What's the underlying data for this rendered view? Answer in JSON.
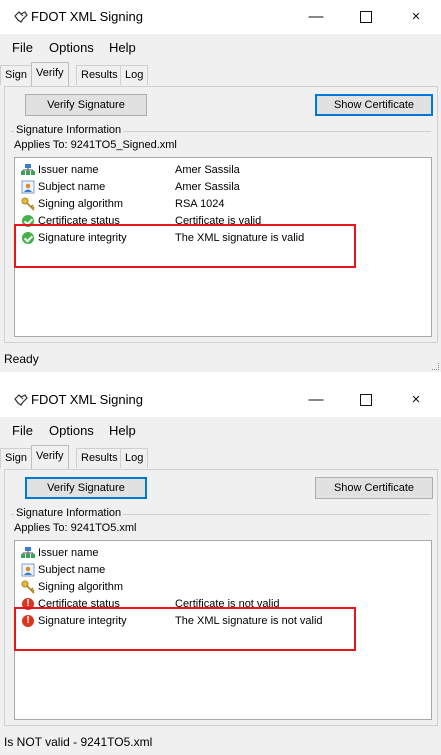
{
  "app_title": "FDOT XML Signing",
  "window_controls": {
    "minimize": "—",
    "close": "×"
  },
  "menu": [
    "File",
    "Options",
    "Help"
  ],
  "tabs": [
    "Sign",
    "Verify",
    "Results",
    "Log"
  ],
  "active_tab": "Verify",
  "buttons": {
    "verify": "Verify Signature",
    "show_certificate": "Show Certificate"
  },
  "group_label": "Signature Information",
  "highlight_color": "#e8141e",
  "windows": [
    {
      "applies_to": "Applies To: 9241TO5_Signed.xml",
      "rows": [
        {
          "name": "Issuer name",
          "value": "Amer Sassila",
          "icon": "issuer-icon"
        },
        {
          "name": "Subject name",
          "value": "Amer Sassila",
          "icon": "subject-icon"
        },
        {
          "name": "Signing algorithm",
          "value": "RSA 1024",
          "icon": "key-icon"
        },
        {
          "name": "Certificate status",
          "value": "Certificate is valid",
          "icon": "check-circle-icon"
        },
        {
          "name": "Signature integrity",
          "value": "The XML signature is valid",
          "icon": "check-circle-icon"
        }
      ],
      "status": "Ready"
    },
    {
      "applies_to": "Applies To: 9241TO5.xml",
      "rows": [
        {
          "name": "Issuer name",
          "value": "",
          "icon": "issuer-icon"
        },
        {
          "name": "Subject name",
          "value": "",
          "icon": "subject-icon"
        },
        {
          "name": "Signing algorithm",
          "value": "",
          "icon": "key-icon"
        },
        {
          "name": "Certificate status",
          "value": "Certificate is not valid",
          "icon": "error-circle-icon"
        },
        {
          "name": "Signature integrity",
          "value": "The XML signature is not valid",
          "icon": "error-circle-icon"
        }
      ],
      "status": "Is NOT valid - 9241TO5.xml"
    }
  ]
}
